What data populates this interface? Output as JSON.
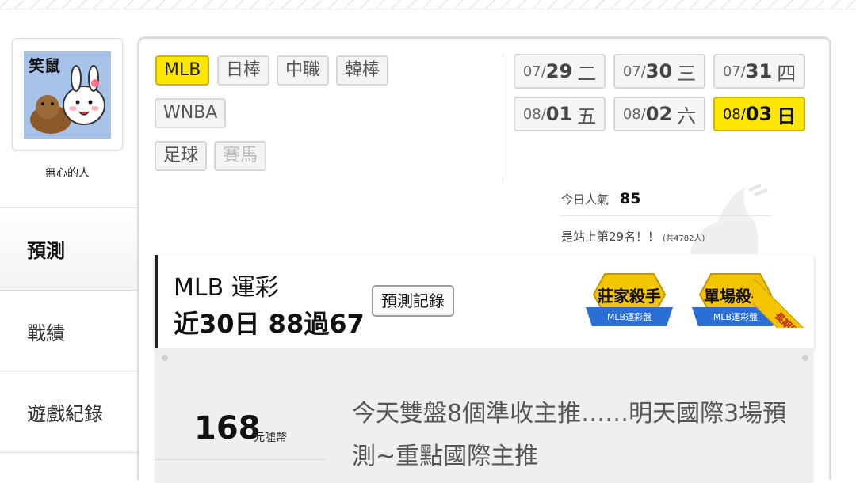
{
  "user": {
    "avatar_text": "笑鼠",
    "name": "無心的人"
  },
  "nav": {
    "items": [
      {
        "label": "預測"
      },
      {
        "label": "戰績"
      },
      {
        "label": "遊戲紀錄"
      }
    ]
  },
  "leagues": [
    {
      "label": "MLB"
    },
    {
      "label": "日棒"
    },
    {
      "label": "中職"
    },
    {
      "label": "韓棒"
    },
    {
      "label": "WNBA"
    },
    {
      "label": "足球"
    },
    {
      "label": "賽馬"
    }
  ],
  "dates": [
    {
      "md": "07/",
      "d": "29",
      "wd": "二"
    },
    {
      "md": "07/",
      "d": "30",
      "wd": "三"
    },
    {
      "md": "07/",
      "d": "31",
      "wd": "四"
    },
    {
      "md": "08/",
      "d": "01",
      "wd": "五"
    },
    {
      "md": "08/",
      "d": "02",
      "wd": "六"
    },
    {
      "md": "08/",
      "d": "03",
      "wd": "日"
    }
  ],
  "stats": {
    "today_label": "今日人氣",
    "today_value": "85",
    "rank_text": "是站上第29名！！",
    "rank_total": "(共4782人)"
  },
  "card": {
    "title": "MLB 運彩",
    "record": "近30日 88過67",
    "record_button": "預測記錄",
    "badges": [
      {
        "title": "莊家殺手",
        "sub": "MLB運彩盤"
      },
      {
        "title": "單場殺手",
        "sub": "MLB運彩盤"
      }
    ],
    "ribbon": "長期穩定"
  },
  "post": {
    "price": "168",
    "unit": "元噓幣",
    "headline": "今天雙盤8個準收主推……明天國際3場預測~重點國際主推"
  },
  "colors": {
    "active": "#ffe600",
    "badge_gold": "#f2c500",
    "badge_blue": "#2a6fd6"
  }
}
